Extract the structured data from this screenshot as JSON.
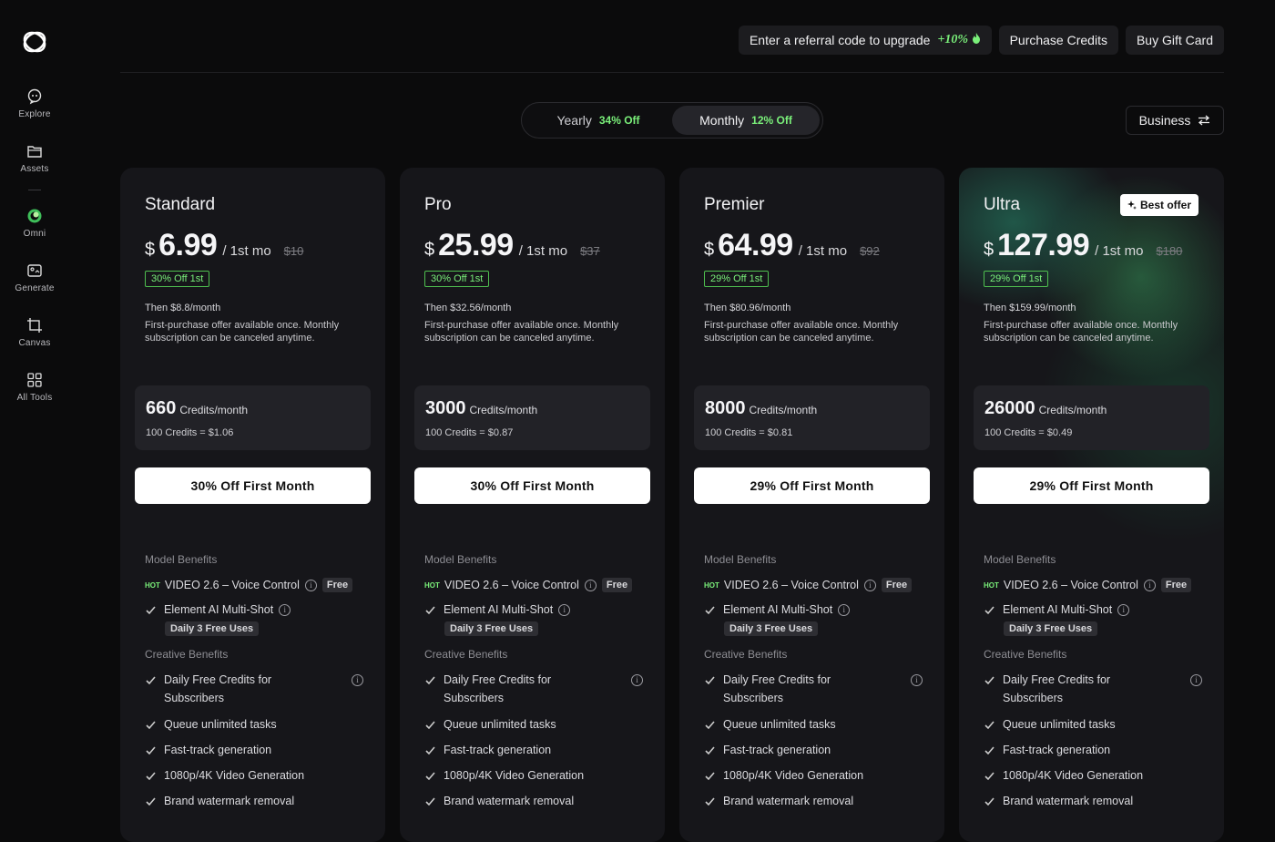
{
  "sidebar": {
    "items": [
      {
        "label": "Explore",
        "icon": "chat-bubble-icon"
      },
      {
        "label": "Assets",
        "icon": "folder-icon"
      },
      {
        "label": "Omni",
        "icon": "omni-orb-icon"
      },
      {
        "label": "Generate",
        "icon": "generate-icon"
      },
      {
        "label": "Canvas",
        "icon": "canvas-frame-icon"
      },
      {
        "label": "All Tools",
        "icon": "grid-icon"
      }
    ]
  },
  "topbar": {
    "referral_label": "Enter a referral code to upgrade",
    "referral_bonus": "+10%",
    "purchase_label": "Purchase Credits",
    "gift_label": "Buy Gift Card"
  },
  "billing": {
    "yearly_label": "Yearly",
    "yearly_off": "34% Off",
    "monthly_label": "Monthly",
    "monthly_off": "12% Off",
    "selected": "Monthly"
  },
  "business_label": "Business",
  "plans": [
    {
      "name": "Standard",
      "currency": "$",
      "price": "6.99",
      "per": "/ 1st mo",
      "old": "$10",
      "pct": "30% Off 1st",
      "then_prefix": "Then ",
      "then_price": "$8.8",
      "then_suffix": "/month",
      "desc": "First-purchase offer available once. Monthly subscription can be canceled anytime.",
      "credits": "660",
      "credits_unit": "Credits/month",
      "rate_prefix": "100 Credits = ",
      "rate": "$1.06",
      "cta": "30% Off First Month"
    },
    {
      "name": "Pro",
      "currency": "$",
      "price": "25.99",
      "per": "/ 1st mo",
      "old": "$37",
      "pct": "30% Off 1st",
      "then_prefix": "Then ",
      "then_price": "$32.56",
      "then_suffix": "/month",
      "desc": "First-purchase offer available once. Monthly subscription can be canceled anytime.",
      "credits": "3000",
      "credits_unit": "Credits/month",
      "rate_prefix": "100 Credits = ",
      "rate": "$0.87",
      "cta": "30% Off First Month"
    },
    {
      "name": "Premier",
      "currency": "$",
      "price": "64.99",
      "per": "/ 1st mo",
      "old": "$92",
      "pct": "29% Off 1st",
      "then_prefix": "Then ",
      "then_price": "$80.96",
      "then_suffix": "/month",
      "desc": "First-purchase offer available once. Monthly subscription can be canceled anytime.",
      "credits": "8000",
      "credits_unit": "Credits/month",
      "rate_prefix": "100 Credits = ",
      "rate": "$0.81",
      "cta": "29% Off First Month"
    },
    {
      "name": "Ultra",
      "badge": "Best offer",
      "currency": "$",
      "price": "127.99",
      "per": "/ 1st mo",
      "old": "$180",
      "pct": "29% Off 1st",
      "then_prefix": "Then ",
      "then_price": "$159.99",
      "then_suffix": "/month",
      "desc": "First-purchase offer available once. Monthly subscription can be canceled anytime.",
      "credits": "26000",
      "credits_unit": "Credits/month",
      "rate_prefix": "100 Credits = ",
      "rate": "$0.49",
      "cta": "29% Off First Month"
    }
  ],
  "benefits": {
    "model_title": "Model Benefits",
    "hot_tag": "HOT",
    "video_feature": "VIDEO 2.6 – Voice Control",
    "free_tag": "Free",
    "element_feature": "Element AI Multi-Shot",
    "daily_tag": "Daily 3 Free Uses",
    "creative_title": "Creative Benefits",
    "creative_items": [
      "Daily Free Credits for Subscribers",
      "Queue unlimited tasks",
      "Fast-track generation",
      "1080p/4K Video Generation",
      "Brand watermark removal"
    ],
    "info_glyph": "i"
  },
  "colors": {
    "accent_green": "#7af07a",
    "background": "#0b0b0c",
    "card": "#16161a"
  }
}
